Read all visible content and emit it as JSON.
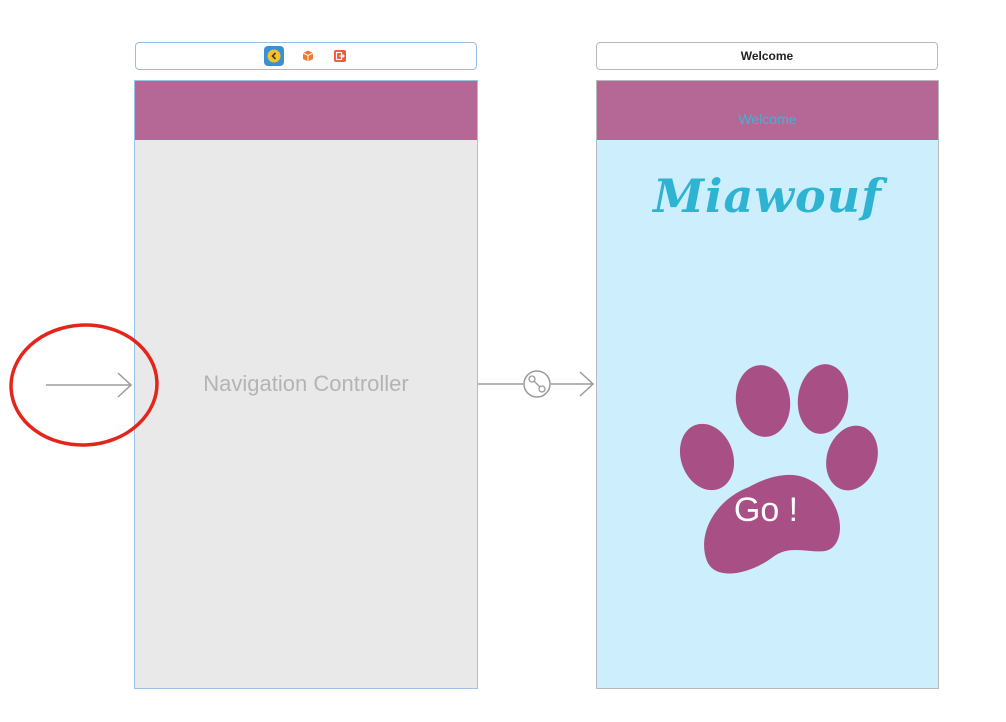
{
  "navigation_scene": {
    "caption": "Navigation Controller",
    "dock_icons": [
      "navigation-controller-icon",
      "first-responder-icon",
      "exit-icon"
    ]
  },
  "welcome_scene": {
    "dock_title": "Welcome",
    "navbar_title": "Welcome",
    "logo_text": "Miawouf",
    "go_button_label": "Go !"
  },
  "colors": {
    "navbar": "#b56795",
    "welcome_background": "#cdeefc",
    "paw": "#a84f86",
    "logo": "#2fb3d3",
    "highlight_circle": "#e3261c"
  }
}
